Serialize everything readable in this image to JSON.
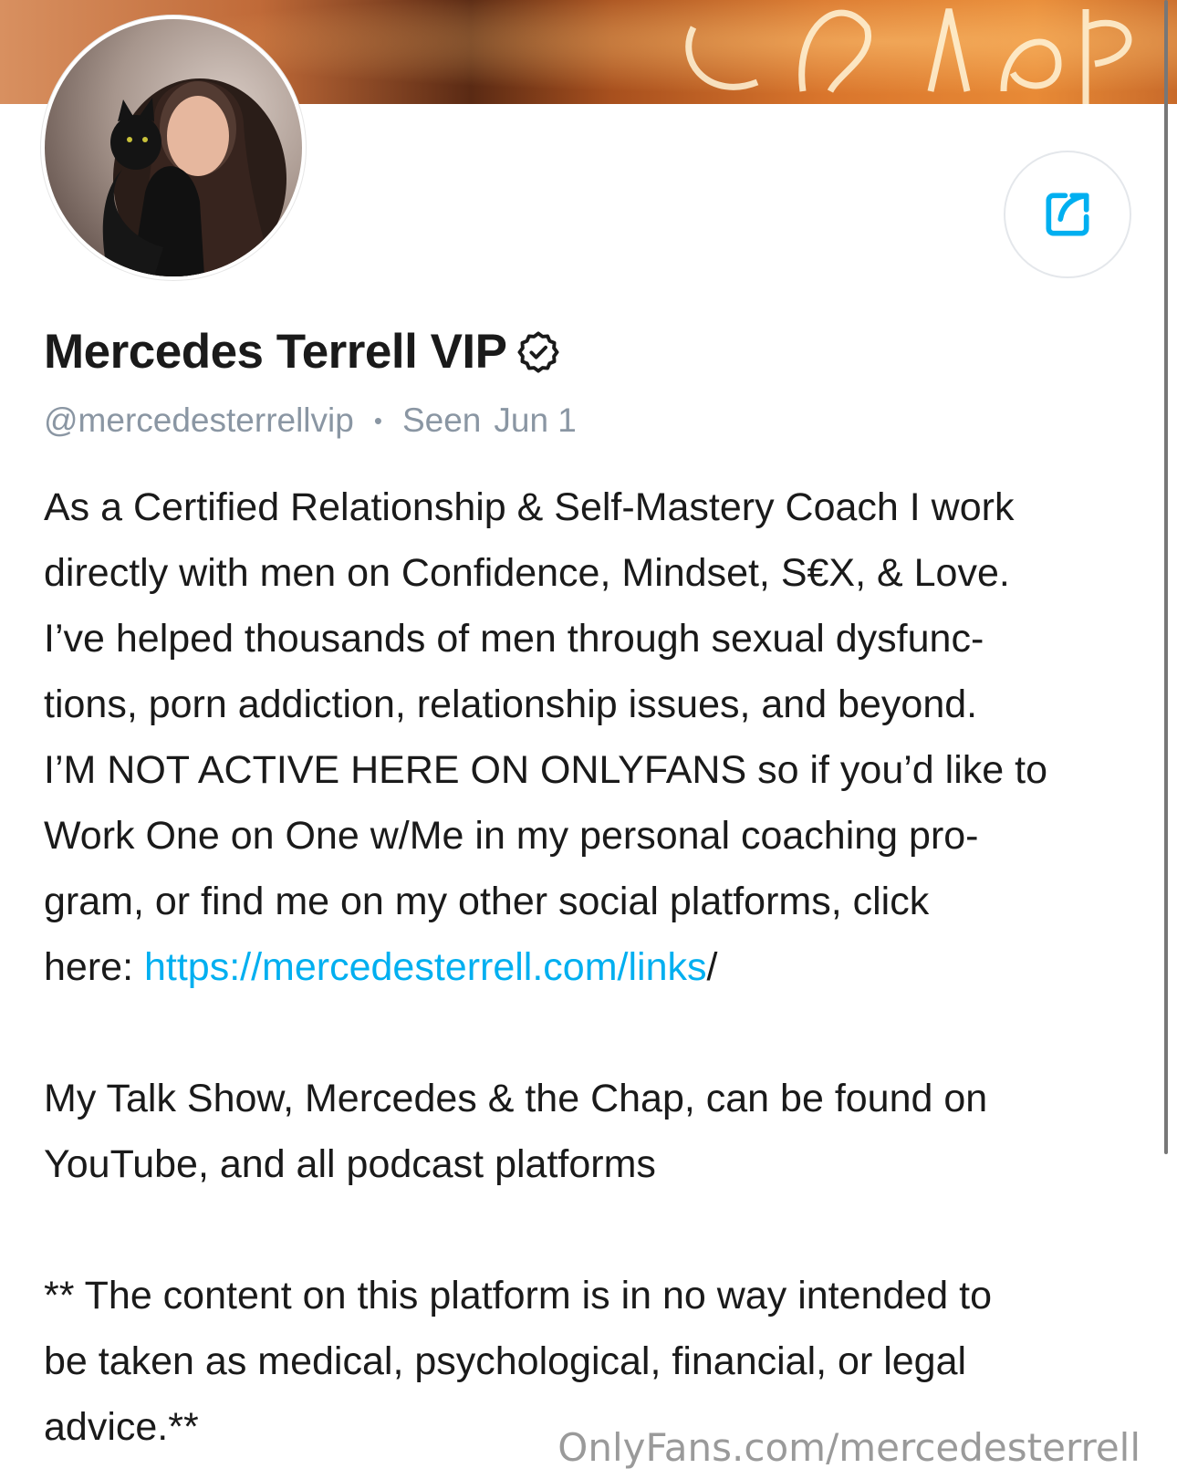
{
  "profile": {
    "name": "Mercedes Terrell VIP",
    "handle": "@mercedesterrellvip",
    "separator": "•",
    "seen_label": "Seen",
    "seen_date": "Jun 1"
  },
  "bio": {
    "p1_lines": [
      "As a Certified Relationship & Self-Mastery Coach I work",
      "directly with men on Confidence, Mindset, S€X, & Love.",
      "I’ve helped thousands of men through sexual dysfunc-",
      "tions, porn addiction, relationship issues, and beyond.",
      "I’M NOT ACTIVE HERE ON ONLYFANS so if you’d like to",
      "Work One on One w/Me in my personal coaching pro-",
      "gram, or find me on my other social platforms, click"
    ],
    "link_prefix": "here: ",
    "link_text": "https://mercedesterrell.com/links",
    "link_suffix": "/",
    "p2_lines": [
      "My Talk Show, Mercedes & the Chap, can be found on",
      "YouTube, and all podcast platforms"
    ],
    "p3_lines": [
      "** The content on this platform is in no way intended to",
      "be taken as medical, psychological, financial, or legal",
      "advice.**"
    ]
  },
  "icons": {
    "share": "share-icon",
    "verified": "verified-badge-icon"
  },
  "colors": {
    "link": "#00aff0",
    "muted": "#8a96a3",
    "text": "#1a1a1a"
  },
  "watermark": "OnlyFans.com/mercedesterrell"
}
